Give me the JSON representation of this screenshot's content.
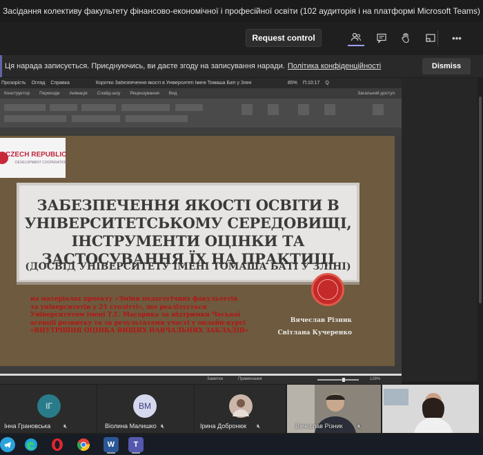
{
  "meeting": {
    "title": "Засідання колективу факультету фінансово-економічної і професійної освіти (102 аудиторія і на платформі Microsoft Teams)",
    "request_control_label": "Request control",
    "controls": [
      "people-icon",
      "chat-icon",
      "raise-hand-icon",
      "share-icon",
      "more-icon"
    ],
    "more_label": "•••"
  },
  "banner": {
    "text": "Ця нарада записується. Приєднуючись, ви даєте згоду на записування наради.",
    "link": "Політика конфіденційності",
    "dismiss_label": "Dismiss"
  },
  "ppt": {
    "top_items": [
      "Прозорість",
      "Огляд",
      "Справка"
    ],
    "doc_title": "Коротко Забезпечення якості в Університеті Імені Томаша Баті у Зліні",
    "status_right": [
      "85%",
      "П:10:17",
      "Q"
    ],
    "ribbon_tabs": [
      "Конструктор",
      "Переходи",
      "Анімація",
      "Слайд-шоу",
      "Рецензування",
      "Вид"
    ],
    "share_label": "Загальний доступ",
    "status_bar": [
      "Заметки",
      "Примечания",
      "128%"
    ]
  },
  "slide": {
    "logo_text": "CZECH REPUBLIC",
    "logo_sub": "DEVELOPMENT COOPERATION",
    "title_lines": [
      "ЗАБЕЗПЕЧЕННЯ ЯКОСТІ ОСВІТИ В",
      "УНІВЕРСИТЕТСЬКОМУ СЕРЕДОВИЩІ,",
      "ІНСТРУМЕНТИ ОЦІНКИ ТА",
      "ЗАСТОСУВАННЯ ЇХ НА ПРАКТИЦІ"
    ],
    "subtitle": "(ДОСВІД УНІВЕРСИТЕТУ ІМЕНІ ТОМАША БАТІ У ЗЛІНІ)",
    "description_lines": [
      "на матеріалах проекту «Зміни педагогічних факультетів",
      "та університетів у 21 столітті», що реалізується",
      "Університетом імені Т.Г. Масарика за підтримки Чеської",
      "агенції розвитку та за результатами участі у онлайн-курсі",
      "«ВНУТРІШНЯ ОЦІНКА ВИЩИХ НАВЧАЛЬНИХ ЗАКЛАДІВ»"
    ],
    "authors": [
      "Вячеслав Різник",
      "Світлана Кучеренко"
    ]
  },
  "participants": [
    {
      "initials": "ІГ",
      "name": "Інна Грановська",
      "color": "#2a7b8a",
      "text_color": "#dff3f6"
    },
    {
      "initials": "ВМ",
      "name": "Віолина Малишко",
      "color": "#d6d8ee",
      "text_color": "#3a3f7a"
    },
    {
      "initials": "",
      "name": "Ірина Добронюк",
      "color": "#c9b8ae",
      "text_color": "#333"
    },
    {
      "initials": "",
      "name": "Вячеслав Різник",
      "color": "#6b6660",
      "text_color": "#fff"
    },
    {
      "initials": "",
      "name": "",
      "color": "#d8d8d8",
      "text_color": "#333"
    }
  ],
  "taskbar": [
    "telegram",
    "edge",
    "opera",
    "chrome",
    "word",
    "teams"
  ],
  "taskbar_labels": {
    "word": "W",
    "teams": "T"
  }
}
